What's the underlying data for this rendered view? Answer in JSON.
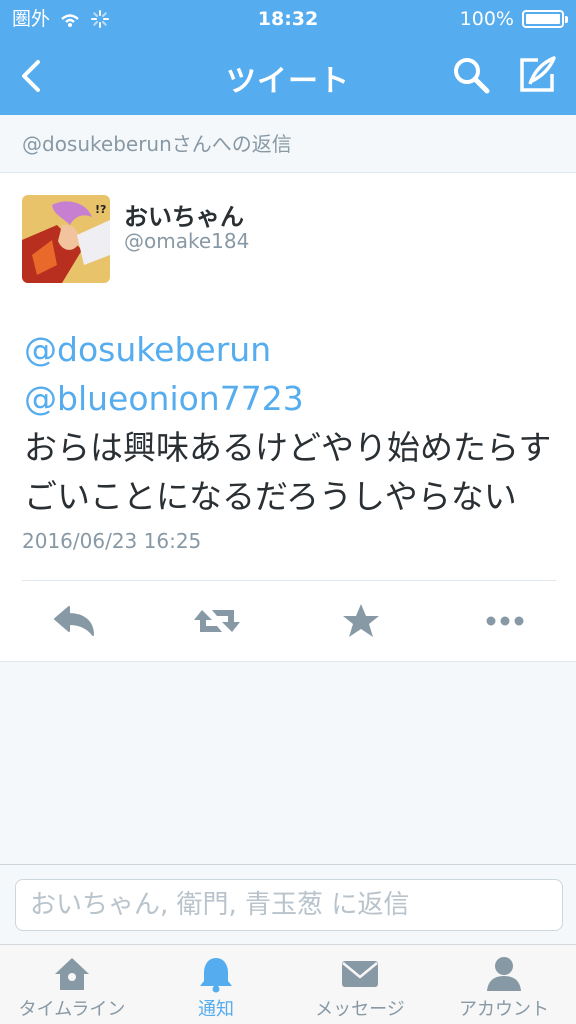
{
  "status_bar": {
    "carrier": "圏外",
    "time": "18:32",
    "battery": "100%"
  },
  "nav": {
    "title": "ツイート",
    "back_icon": "chevron-left-icon",
    "search_icon": "search-icon",
    "compose_icon": "compose-icon"
  },
  "reply_context": "@dosukeberunさんへの返信",
  "tweet": {
    "display_name": "おいちゃん",
    "handle": "@omake184",
    "mention_1": "@dosukeberun",
    "mention_2": "@blueonion7723",
    "text": "おらは興味あるけどやり始めたらすごいことになるだろうしやらない",
    "timestamp": "2016/06/23 16:25",
    "actions": [
      "reply-icon",
      "retweet-icon",
      "favorite-icon",
      "more-icon"
    ]
  },
  "compose": {
    "placeholder": "おいちゃん, 衛門, 青玉葱 に返信"
  },
  "tabs": [
    {
      "label": "タイムライン",
      "icon": "home-icon",
      "active": false
    },
    {
      "label": "通知",
      "icon": "bell-icon",
      "active": true
    },
    {
      "label": "メッセージ",
      "icon": "envelope-icon",
      "active": false
    },
    {
      "label": "アカウント",
      "icon": "person-icon",
      "active": false
    }
  ],
  "colors": {
    "accent": "#55acee",
    "text": "#292f33",
    "muted": "#8899a6",
    "background": "#f5f8fa"
  }
}
